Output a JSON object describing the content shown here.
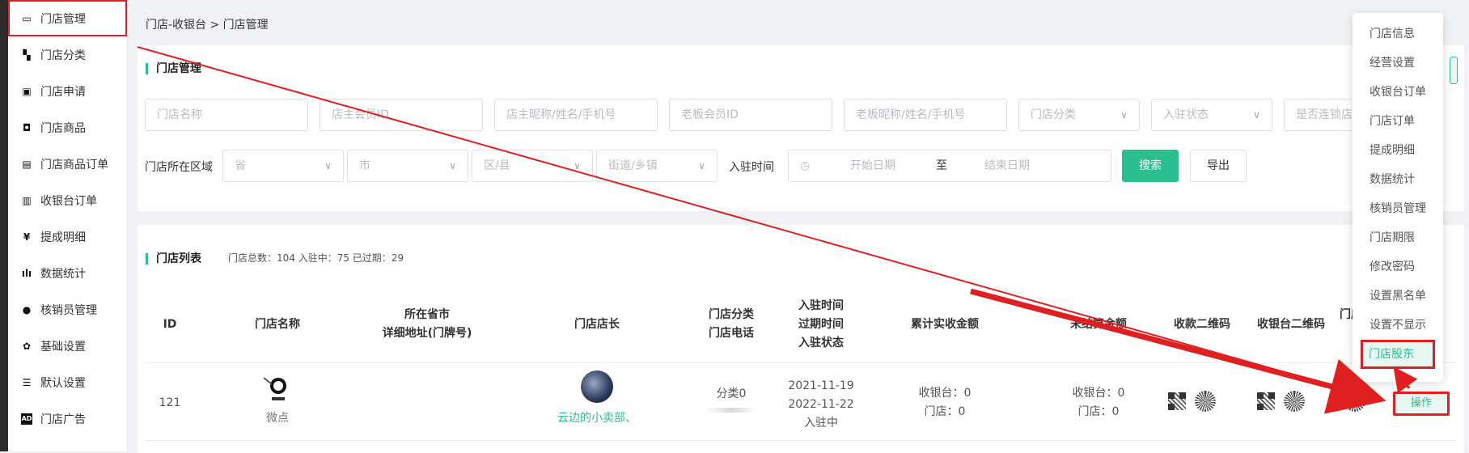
{
  "sidebar": {
    "items": [
      {
        "label": "门店管理",
        "icon": "store-icon"
      },
      {
        "label": "门店分类",
        "icon": "grid-icon"
      },
      {
        "label": "门店申请",
        "icon": "inbox-icon"
      },
      {
        "label": "门店商品",
        "icon": "bag-icon"
      },
      {
        "label": "门店商品订单",
        "icon": "clipboard-icon"
      },
      {
        "label": "收银台订单",
        "icon": "receipt-icon"
      },
      {
        "label": "提成明细",
        "icon": "yuan-icon"
      },
      {
        "label": "数据统计",
        "icon": "chart-icon"
      },
      {
        "label": "核销员管理",
        "icon": "user-icon"
      },
      {
        "label": "基础设置",
        "icon": "gear-icon"
      },
      {
        "label": "默认设置",
        "icon": "list-icon"
      },
      {
        "label": "门店广告",
        "icon": "ad-icon"
      }
    ]
  },
  "breadcrumb": "门店-收银台 > 门店管理",
  "filter": {
    "title": "门店管理",
    "placeholders": {
      "store_name": "门店名称",
      "owner_member_id": "店主会员ID",
      "owner_info": "店主昵称/姓名/手机号",
      "boss_member_id": "老板会员ID",
      "boss_info": "老板昵称/姓名/手机号",
      "category": "门店分类",
      "status": "入驻状态",
      "chain": "是否连锁店",
      "province": "省",
      "city": "市",
      "district": "区/县",
      "street": "街道/乡镇",
      "start_date": "开始日期",
      "end_date": "结束日期"
    },
    "region_label": "门店所在区域",
    "time_label": "入驻时间",
    "date_sep": "至",
    "search_button": "搜索",
    "export_button": "导出"
  },
  "list": {
    "title": "门店列表",
    "stats": "门店总数：104   入驻中：75   已过期：29",
    "headers": {
      "id": "ID",
      "name": "门店名称",
      "address_1": "所在省市",
      "address_2": "详细地址(门牌号)",
      "manager": "门店店长",
      "cat_1": "门店分类",
      "cat_2": "门店电话",
      "time_1": "入驻时间",
      "time_2": "过期时间",
      "time_3": "入驻状态",
      "total": "累计实收金额",
      "unsettled": "未结算金额",
      "pay_qr": "收款二维码",
      "cashier_qr": "收银台二维码",
      "store_qr": "门店"
    },
    "rows": [
      {
        "id": "121",
        "name": "微点",
        "logo_caption": "微点",
        "manager": "云边的小卖部、",
        "category": "分类0",
        "join_date": "2021-11-19",
        "expire_date": "2022-11-22",
        "status": "入驻中",
        "total_1": "收银台：0",
        "total_2": "门店：0",
        "unsettled_1": "收银台：0",
        "unsettled_2": "门店：0",
        "op_button": "操作"
      }
    ]
  },
  "dropdown": {
    "items": [
      "门店信息",
      "经营设置",
      "收银台订单",
      "门店订单",
      "提成明细",
      "数据统计",
      "核销员管理",
      "门店期限",
      "修改密码",
      "设置黑名单",
      "设置不显示",
      "门店股东"
    ]
  },
  "colors": {
    "accent": "#2bbf8f",
    "annotation": "#e02020"
  }
}
